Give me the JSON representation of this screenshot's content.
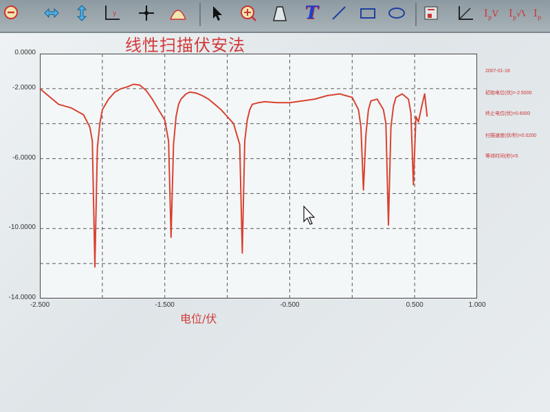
{
  "toolbar": {
    "icons": [
      "zoom-out-icon",
      "pan-horizontal-icon",
      "pan-vertical-icon",
      "axis-icon",
      "crosshair-icon",
      "peak-icon",
      "pointer-icon",
      "zoom-in-icon",
      "bell-shape-icon",
      "text-tool-icon",
      "line-tool-icon",
      "rectangle-tool-icon",
      "ellipse-tool-icon",
      "label-icon",
      "axes-xy-icon",
      "ip-v-icon",
      "ip-sqrt-v-icon",
      "ip-y-icon"
    ],
    "text_tool_glyph": "T"
  },
  "title": "线性扫描伏安法",
  "info_lines": [
    "2007-01-18",
    "初始电位(伏)=-2.5000",
    "终止电位(伏)=0.6000",
    "扫描速度(伏/秒)=0.0200",
    "等待时间(秒)=5"
  ],
  "accent": "#d23a3a",
  "chart_data": {
    "type": "line",
    "title": "线性扫描伏安法",
    "xlabel": "电位/伏",
    "ylabel": "",
    "xlim": [
      -2.5,
      1.0
    ],
    "ylim": [
      -14.0,
      0.0
    ],
    "xticks": [
      "-2.500",
      "-1.500",
      "-0.500",
      "0.500",
      "1.000"
    ],
    "yticks": [
      "0.0000",
      "-2.0000",
      "-6.0000",
      "-10.0000",
      "-14.0000"
    ],
    "grid": true,
    "series": [
      {
        "color": "#d9412f",
        "x": [
          -2.5,
          -2.45,
          -2.35,
          -2.25,
          -2.15,
          -2.1,
          -2.08,
          -2.06,
          -2.04,
          -2.02,
          -2.0,
          -1.95,
          -1.9,
          -1.85,
          -1.8,
          -1.75,
          -1.7,
          -1.65,
          -1.6,
          -1.55,
          -1.5,
          -1.47,
          -1.45,
          -1.43,
          -1.41,
          -1.39,
          -1.37,
          -1.33,
          -1.3,
          -1.25,
          -1.2,
          -1.15,
          -1.1,
          -1.05,
          -1.0,
          -0.95,
          -0.9,
          -0.88,
          -0.86,
          -0.84,
          -0.82,
          -0.8,
          -0.75,
          -0.7,
          -0.6,
          -0.5,
          -0.4,
          -0.3,
          -0.2,
          -0.1,
          0.0,
          0.05,
          0.07,
          0.09,
          0.11,
          0.13,
          0.15,
          0.2,
          0.25,
          0.27,
          0.29,
          0.31,
          0.33,
          0.35,
          0.4,
          0.45,
          0.47,
          0.49,
          0.51,
          0.53,
          0.56,
          0.58,
          0.6
        ],
        "y": [
          -2.0,
          -2.3,
          -2.9,
          -3.1,
          -3.5,
          -4.2,
          -5.0,
          -12.2,
          -5.4,
          -4.0,
          -3.2,
          -2.6,
          -2.2,
          -2.0,
          -1.9,
          -1.75,
          -1.8,
          -2.1,
          -2.6,
          -3.2,
          -3.8,
          -5.0,
          -10.5,
          -5.2,
          -3.6,
          -2.9,
          -2.6,
          -2.3,
          -2.2,
          -2.25,
          -2.4,
          -2.6,
          -2.9,
          -3.2,
          -3.6,
          -4.0,
          -5.2,
          -11.4,
          -5.0,
          -3.8,
          -3.2,
          -2.9,
          -2.8,
          -2.75,
          -2.8,
          -2.8,
          -2.7,
          -2.6,
          -2.4,
          -2.3,
          -2.5,
          -3.2,
          -4.2,
          -7.8,
          -4.6,
          -3.2,
          -2.7,
          -2.6,
          -3.2,
          -4.0,
          -9.8,
          -4.2,
          -3.0,
          -2.5,
          -2.3,
          -2.6,
          -3.4,
          -7.5,
          -3.6,
          -3.9,
          -2.9,
          -2.3,
          -3.6
        ]
      }
    ]
  }
}
